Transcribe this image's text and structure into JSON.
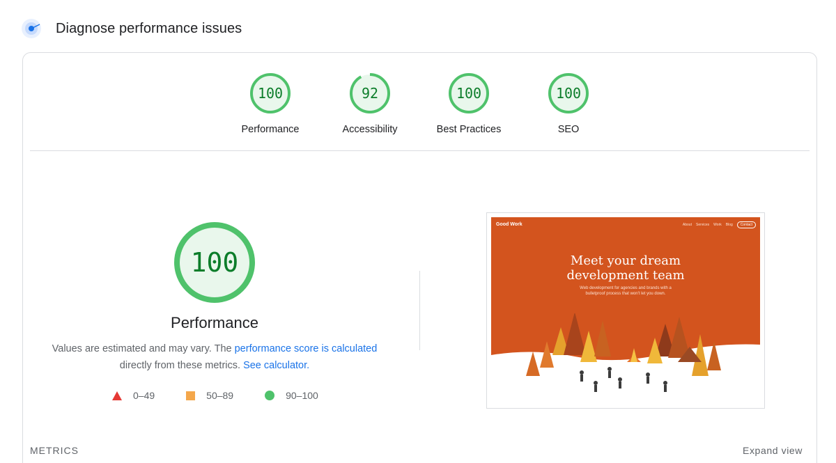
{
  "header": {
    "title": "Diagnose performance issues",
    "icon": "radar-icon"
  },
  "categories": [
    {
      "label": "Performance",
      "score": "100",
      "value": 100
    },
    {
      "label": "Accessibility",
      "score": "92",
      "value": 92
    },
    {
      "label": "Best Practices",
      "score": "100",
      "value": 100
    },
    {
      "label": "SEO",
      "score": "100",
      "value": 100
    }
  ],
  "main": {
    "score": "100",
    "value": 100,
    "title": "Performance",
    "desc_before": "Values are estimated and may vary. The ",
    "desc_link1": "performance score is calculated",
    "desc_middle": " directly from these metrics. ",
    "desc_link2": "See calculator."
  },
  "legend": [
    {
      "range": "0–49",
      "shape": "triangle",
      "color": "#e53935"
    },
    {
      "range": "50–89",
      "shape": "square",
      "color": "#f4a74b"
    },
    {
      "range": "90–100",
      "shape": "circle",
      "color": "#4fc26b"
    }
  ],
  "screenshot": {
    "brand": "Good Work",
    "nav": [
      "About",
      "Services",
      "Work",
      "Blog"
    ],
    "contact": "Contact",
    "headline_line1": "Meet your dream",
    "headline_line2": "development team",
    "sub_line1": "Web development for agencies and brands with a",
    "sub_line2": "bulletproof process that won't let you down."
  },
  "footer": {
    "metrics_label": "METRICS",
    "expand_label": "Expand view"
  },
  "colors": {
    "pass": "#0c7d2a",
    "pass_ring": "#4fc26b",
    "pass_bg": "#e9f7ec",
    "link": "#1a73e8"
  }
}
